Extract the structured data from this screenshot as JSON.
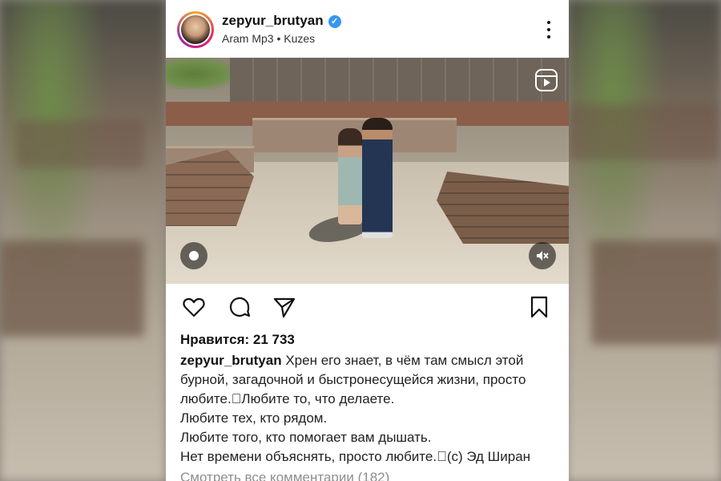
{
  "post": {
    "username": "zepyur_brutyan",
    "subtitle": "Aram Mp3 • Kuzes",
    "likes": "Нравится: 21 733",
    "caption_user": "zepyur_brutyan",
    "caption_lines": [
      "Хрен его знает, в чём там смысл этой",
      "бурной, загадочной и быстронесущейся жизни, просто",
      "любите.\u0000Любите то, что делаете.",
      "Любите тех, кто рядом.",
      "Любите того, кто помогает вам дышать.",
      "Нет времени объяснять, просто любите.\u0000(c) Эд Ширан"
    ],
    "view_comments": "Смотреть все комментарии (182)"
  },
  "icons": {
    "verified": "verified-badge-icon",
    "more": "more-options-icon",
    "reels": "reels-icon",
    "tag": "tagged-user-icon",
    "mute": "muted-speaker-icon",
    "like": "heart-icon",
    "comment": "comment-icon",
    "share": "paper-plane-icon",
    "save": "bookmark-icon"
  },
  "colors": {
    "verified": "#3897f0",
    "text": "#111111",
    "muted_text": "#8e8e8e"
  }
}
